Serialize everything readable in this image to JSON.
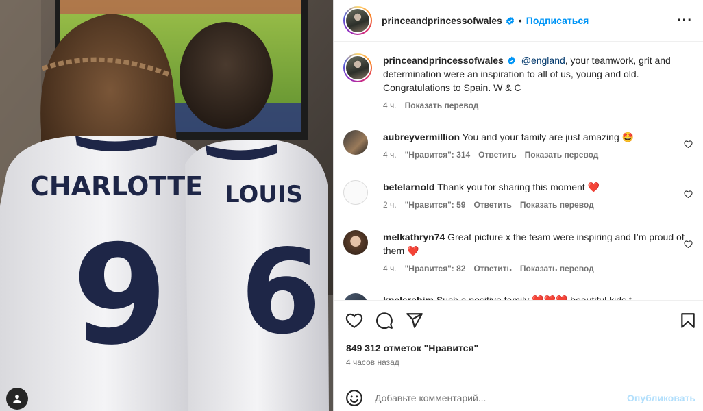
{
  "post": {
    "username": "princeandprincessofwales",
    "follow_label": "Подписаться",
    "caption_mention": "@england",
    "caption_text": ", your teamwork, grit and determination were an inspiration to all of us, young and old. Congratulations to Spain. W & C",
    "caption_time": "4 ч.",
    "caption_translate": "Показать перевод",
    "likes": "849 312 отметок \"Нравится\"",
    "posted": "4 часов назад"
  },
  "photo": {
    "name1": "CHARLOTTE",
    "number1": "9",
    "name2": "LOUIS",
    "number2": "6"
  },
  "comments": [
    {
      "user": "aubreyvermillion",
      "text": "You and your family are just amazing",
      "emoji": "🤩",
      "time": "4 ч.",
      "likes": "\"Нравится\": 314",
      "reply": "Ответить",
      "translate": "Показать перевод"
    },
    {
      "user": "betelarnold",
      "text": "Thank you for sharing this moment",
      "emoji": "❤️",
      "time": "2 ч.",
      "likes": "\"Нравится\": 59",
      "reply": "Ответить",
      "translate": "Показать перевод"
    },
    {
      "user": "melkathryn74",
      "text": "Great picture x the team were inspiring and I’m proud of them",
      "emoji": "❤️",
      "time": "4 ч.",
      "likes": "\"Нравится\": 82",
      "reply": "Ответить",
      "translate": "Показать перевод"
    },
    {
      "user": "kpelsrahim",
      "text": "Such a positive family",
      "emoji": "❤️❤️❤️ beautiful kids t",
      "time": "",
      "likes": "",
      "reply": "",
      "translate": ""
    }
  ],
  "add_comment": {
    "placeholder": "Добавьте комментарий...",
    "publish_label": "Опубликовать"
  },
  "colors": {
    "link": "#0095f6",
    "verified": "#0095f6",
    "heart": "#ed4956",
    "mention": "#00376b"
  },
  "icons": [
    "verified-badge-icon",
    "more-options-icon",
    "heart-icon",
    "comment-icon",
    "share-icon",
    "save-icon",
    "emoji-icon",
    "user-tag-icon"
  ]
}
